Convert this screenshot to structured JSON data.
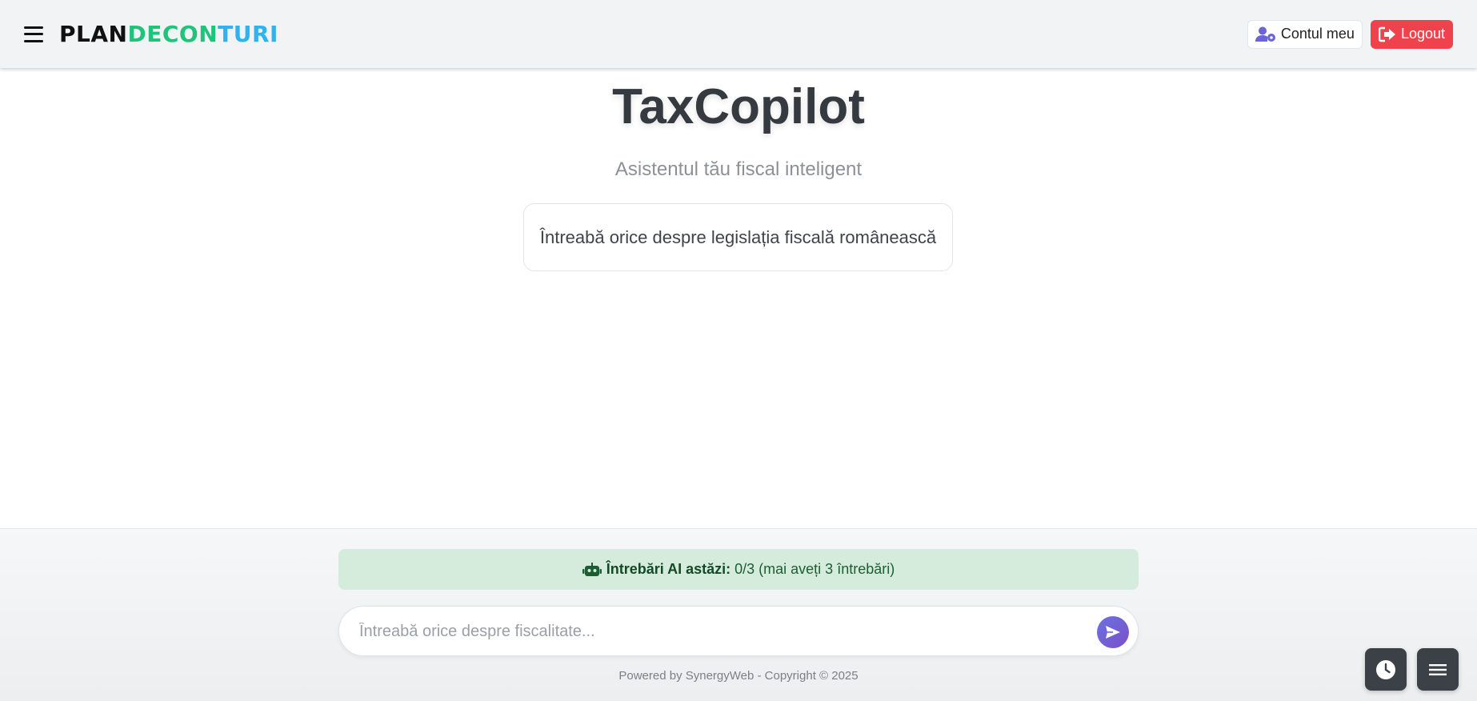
{
  "header": {
    "logo": {
      "part1": "PLAN",
      "part2": "DECON",
      "part3": "TURI"
    },
    "account_label": "Contul meu",
    "logout_label": "Logout"
  },
  "hero": {
    "title": "TaxCopilot",
    "subtitle": "Asistentul tău fiscal inteligent",
    "card_text": "Întreabă orice despre legislația fiscală românească"
  },
  "quota": {
    "label": "Întrebări AI astăzi:",
    "value": "0/3 (mai aveți 3 întrebări)"
  },
  "chat": {
    "placeholder": "Întreabă orice despre fiscalitate...",
    "value": ""
  },
  "footer": {
    "text": "Powered by SynergyWeb - Copyright © 2025"
  },
  "icons": {
    "menu": "hamburger-icon",
    "account": "user-gear-icon",
    "logout": "sign-out-icon",
    "robot": "robot-icon",
    "send": "paper-plane-icon",
    "history": "clock-icon",
    "floating_menu": "bars-icon"
  },
  "colors": {
    "logo_green": "#1ec47a",
    "logo_blue": "#2fb3ee",
    "logout_red": "#f0424c",
    "quota_bg": "#d5ecdc",
    "send_gradient_start": "#6b72e0",
    "send_gradient_end": "#7a4fc9"
  }
}
